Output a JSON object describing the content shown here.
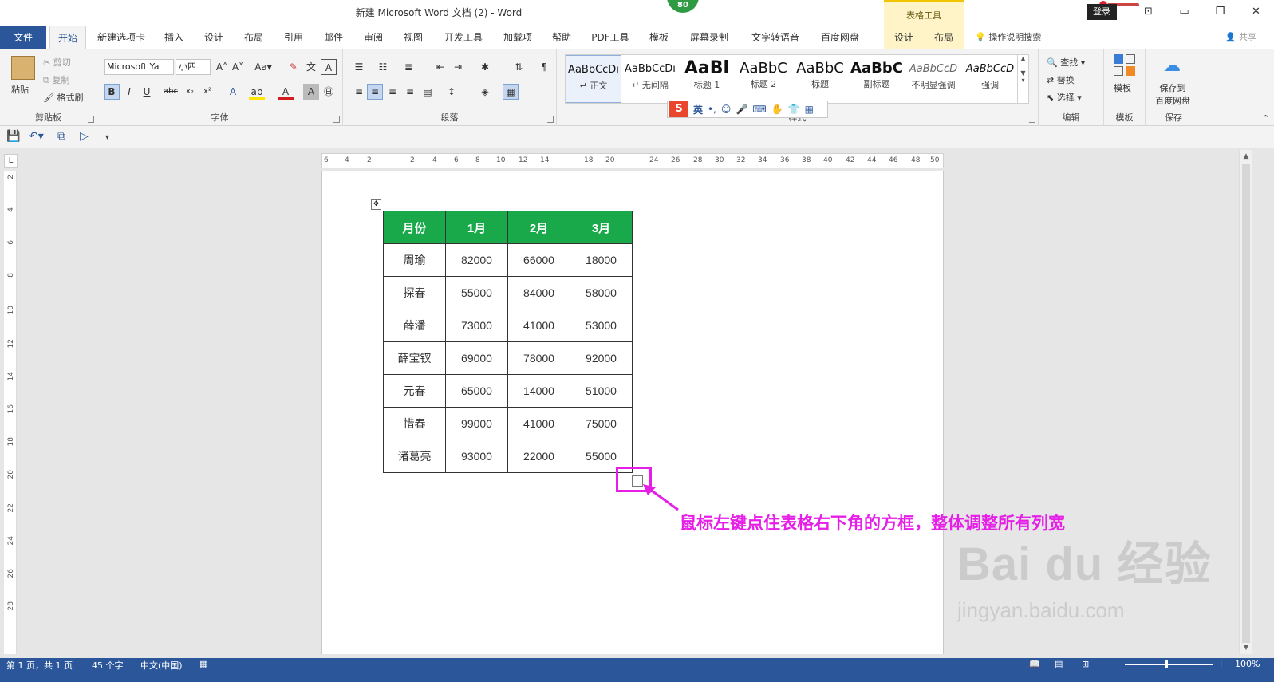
{
  "window": {
    "title": "新建 Microsoft Word 文档 (2)  -  Word",
    "badge": "80",
    "context_tab": "表格工具",
    "login": "登录",
    "controls": [
      "⊡",
      "▭",
      "❐",
      "✕"
    ]
  },
  "tabs": {
    "file": "文件",
    "items": [
      "开始",
      "新建选项卡",
      "插入",
      "设计",
      "布局",
      "引用",
      "邮件",
      "审阅",
      "视图",
      "开发工具",
      "加载项",
      "帮助",
      "PDF工具",
      "模板",
      "屏幕录制",
      "文字转语音",
      "百度网盘"
    ],
    "context_items": [
      "设计",
      "布局"
    ],
    "active": "开始",
    "tell_me": "操作说明搜索",
    "share": "共享"
  },
  "ribbon": {
    "clipboard": {
      "paste": "粘贴",
      "cut": "剪切",
      "copy": "复制",
      "format_painter": "格式刷",
      "label": "剪贴板"
    },
    "font": {
      "font_name": "Microsoft Ya",
      "font_size": "小四",
      "label": "字体",
      "bold": "B",
      "italic": "I",
      "underline": "U"
    },
    "paragraph": {
      "label": "段落"
    },
    "styles": {
      "label": "样式",
      "items": [
        {
          "sample": "AaBbCcDı",
          "name": "↵ 正文"
        },
        {
          "sample": "AaBbCcDı",
          "name": "↵ 无间隔"
        },
        {
          "sample": "AaBl",
          "name": "标题 1"
        },
        {
          "sample": "AaBbC",
          "name": "标题 2"
        },
        {
          "sample": "AaBbC",
          "name": "标题"
        },
        {
          "sample": "AaBbC",
          "name": "副标题"
        },
        {
          "sample": "AaBbCcD",
          "name": "不明显强调"
        },
        {
          "sample": "AaBbCcD",
          "name": "强调"
        }
      ]
    },
    "editing": {
      "find": "查找",
      "replace": "替换",
      "select": "选择",
      "label": "编辑"
    },
    "templates": {
      "button": "模板",
      "label": "模板"
    },
    "save": {
      "button_line1": "保存到",
      "button_line2": "百度网盘",
      "label": "保存"
    },
    "ime": {
      "logo": "S",
      "lang": "英"
    }
  },
  "ruler": {
    "h_ticks": [
      "6",
      "4",
      "2",
      "2",
      "4",
      "6",
      "8",
      "10",
      "12",
      "14",
      "18",
      "20",
      "24",
      "26",
      "28",
      "30",
      "32",
      "34",
      "36",
      "38",
      "40",
      "42",
      "44",
      "46",
      "48",
      "50"
    ],
    "v_ticks": [
      "2",
      "4",
      "6",
      "8",
      "10",
      "12",
      "14",
      "16",
      "18",
      "20",
      "22",
      "24",
      "26",
      "28"
    ],
    "corner": "L"
  },
  "table": {
    "headers": [
      "月份",
      "1月",
      "2月",
      "3月"
    ],
    "rows": [
      [
        "周瑜",
        "82000",
        "66000",
        "18000"
      ],
      [
        "探春",
        "55000",
        "84000",
        "58000"
      ],
      [
        "薛潘",
        "73000",
        "41000",
        "53000"
      ],
      [
        "薛宝钗",
        "69000",
        "78000",
        "92000"
      ],
      [
        "元春",
        "65000",
        "14000",
        "51000"
      ],
      [
        "惜春",
        "99000",
        "41000",
        "75000"
      ],
      [
        "诸葛亮",
        "93000",
        "22000",
        "55000"
      ]
    ],
    "header_color": "#19a84a"
  },
  "annotation": {
    "text": "鼠标左键点住表格右下角的方框，整体调整所有列宽",
    "color": "#e51ee8"
  },
  "watermark": {
    "main": "Bai du 经验",
    "url": "jingyan.baidu.com"
  },
  "status": {
    "page": "第 1 页，共 1 页",
    "words": "45 个字",
    "language": "中文(中国)",
    "zoom": "100%"
  }
}
